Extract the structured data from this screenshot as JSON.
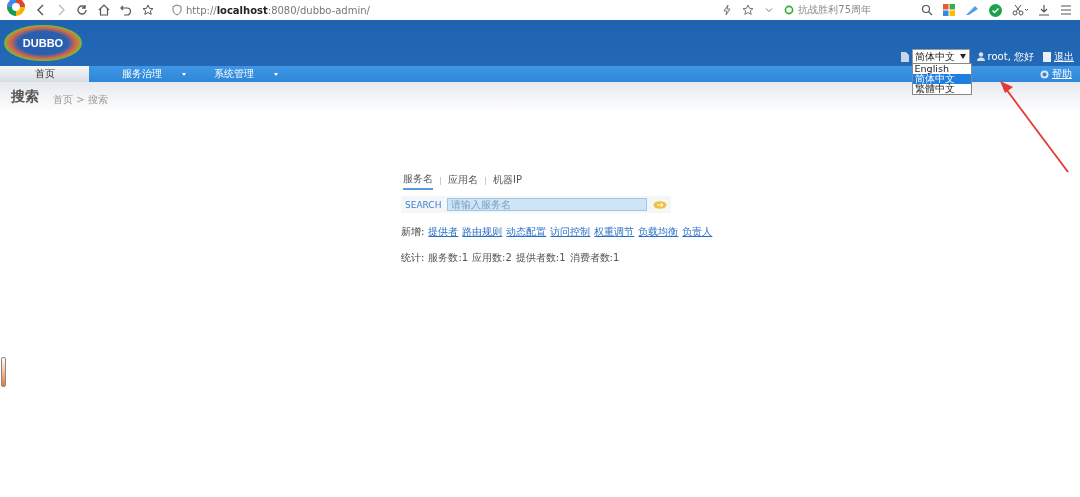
{
  "browser": {
    "url": "http://**localhost**:8080/dubbo-admin/",
    "news": "抗战胜利75周年"
  },
  "header": {
    "logo": "DUBBO",
    "language": {
      "value": "简体中文",
      "expanded": true,
      "options": [
        {
          "label": "English",
          "selected": false
        },
        {
          "label": "简体中文",
          "selected": true
        },
        {
          "label": "繁體中文",
          "selected": false
        }
      ]
    },
    "user": "root, 您好",
    "logout": "退出"
  },
  "nav": {
    "items": [
      {
        "label": "首页",
        "selected": true,
        "has_menu": false
      },
      {
        "label": "服务治理",
        "selected": false,
        "has_menu": true
      },
      {
        "label": "系统管理",
        "selected": false,
        "has_menu": true
      }
    ],
    "help": "帮助"
  },
  "page": {
    "title": "搜索",
    "breadcrumb": "首页 > 搜索"
  },
  "search": {
    "tabs": [
      {
        "label": "服务名",
        "selected": true
      },
      {
        "label": "应用名",
        "selected": false
      },
      {
        "label": "机器IP",
        "selected": false
      }
    ],
    "button": "SEARCH",
    "placeholder": "请输入服务名",
    "add_label": "新增:",
    "add_links": [
      "提供者",
      "路由规则",
      "动态配置",
      "访问控制",
      "权重调节",
      "负载均衡",
      "负责人"
    ],
    "stats_label": "统计:",
    "stats": [
      "服务数:1",
      "应用数:2",
      "提供者数:1",
      "消费者数:1"
    ]
  }
}
